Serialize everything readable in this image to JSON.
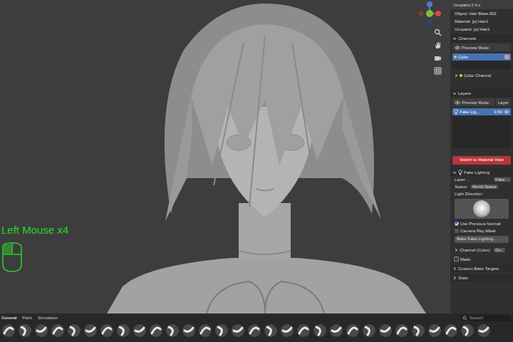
{
  "viewport": {
    "overlay_text": "Left Mouse x4"
  },
  "panel": {
    "title": "Ucupaint 2.4.x",
    "info": [
      "Object: Hair Base.002",
      "Material: [p] Hair1",
      "Ucupaint: [p] Hair1"
    ],
    "channels": {
      "label": "Channels",
      "expanded": true,
      "preview_mode": "Preview Mode",
      "items": [
        {
          "label": "Color",
          "selected": true,
          "color": "#c99a9a"
        }
      ],
      "channel_section": {
        "label": "Color Channel",
        "expanded": false
      }
    },
    "layers": {
      "label": "Layers",
      "expanded": true,
      "preview_mode": "Preview Mode",
      "mode_select": "Layer",
      "items": [
        {
          "label": "Fake Lig...",
          "value": "0.50",
          "selected": true,
          "visible": true
        }
      ]
    },
    "switch_button": "Switch to Material View",
    "layer_props": {
      "label": "Fake Lighting",
      "expanded": true,
      "layer_label": "Layer ...",
      "layer_value": "Fake ...",
      "space_label": "Space:",
      "space_value": "World Space",
      "light_direction": "Light Direction:",
      "options": [
        {
          "label": "Use Previous Normal",
          "checked": true
        },
        {
          "label": "Camera Ray Mask",
          "checked": false
        }
      ],
      "bake_button": "Bake Fake Lighting..."
    },
    "subsections": [
      {
        "kind": "collapsible",
        "label": "Channel (Color):",
        "value": "Ov...",
        "expanded": false,
        "checked": false
      },
      {
        "kind": "checkbox",
        "label": "Mask",
        "value": "",
        "expanded": false,
        "checked": false
      }
    ],
    "footer_sections": [
      {
        "label": "Custom Bake Targets",
        "expanded": false
      },
      {
        "label": "Stats",
        "expanded": false
      }
    ]
  },
  "toolbar": {
    "tabs": [
      {
        "label": "General",
        "selected": true
      },
      {
        "label": "Paint",
        "selected": false
      },
      {
        "label": "Simulation",
        "selected": false
      }
    ],
    "search": {
      "placeholder": "Search"
    }
  }
}
